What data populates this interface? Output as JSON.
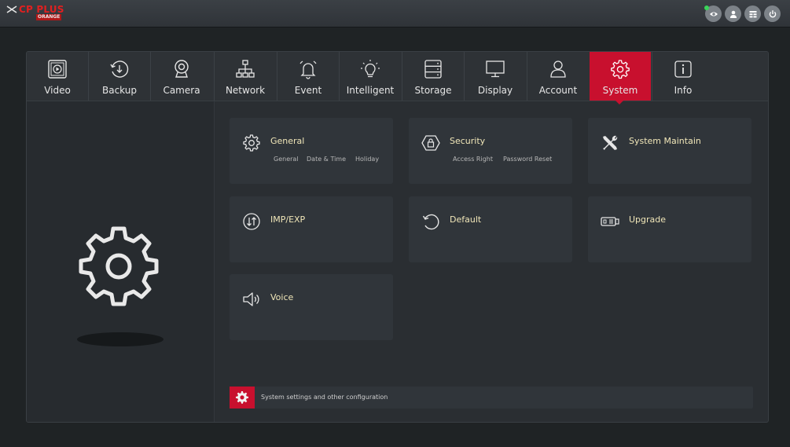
{
  "app": {
    "logo_text": "CP PLUS",
    "logo_sub": "ORANGE"
  },
  "top_icons": [
    "eye-icon",
    "user-icon",
    "grid-icon",
    "power-icon"
  ],
  "tabs": [
    {
      "label": "Video",
      "icon": "video-icon",
      "active": false
    },
    {
      "label": "Backup",
      "icon": "backup-icon",
      "active": false
    },
    {
      "label": "Camera",
      "icon": "camera-icon",
      "active": false
    },
    {
      "label": "Network",
      "icon": "network-icon",
      "active": false
    },
    {
      "label": "Event",
      "icon": "bell-icon",
      "active": false
    },
    {
      "label": "Intelligent",
      "icon": "bulb-icon",
      "active": false
    },
    {
      "label": "Storage",
      "icon": "storage-icon",
      "active": false
    },
    {
      "label": "Display",
      "icon": "monitor-icon",
      "active": false
    },
    {
      "label": "Account",
      "icon": "account-icon",
      "active": false
    },
    {
      "label": "System",
      "icon": "gear-icon",
      "active": true
    },
    {
      "label": "Info",
      "icon": "info-icon",
      "active": false
    }
  ],
  "cards": {
    "general": {
      "title": "General",
      "subs": [
        "General",
        "Date & Time",
        "Holiday"
      ]
    },
    "security": {
      "title": "Security",
      "subs": [
        "Access Right",
        "Password Reset"
      ]
    },
    "system_maintain": {
      "title": "System Maintain"
    },
    "imp_exp": {
      "title": "IMP/EXP"
    },
    "default": {
      "title": "Default"
    },
    "upgrade": {
      "title": "Upgrade"
    },
    "voice": {
      "title": "Voice"
    }
  },
  "footer": {
    "text": "System settings and other configuration"
  },
  "colors": {
    "accent": "#c8102e",
    "background": "#1f2325",
    "panel": "#2a2e32",
    "card": "#30353a",
    "card_title": "#f0e6b8"
  }
}
